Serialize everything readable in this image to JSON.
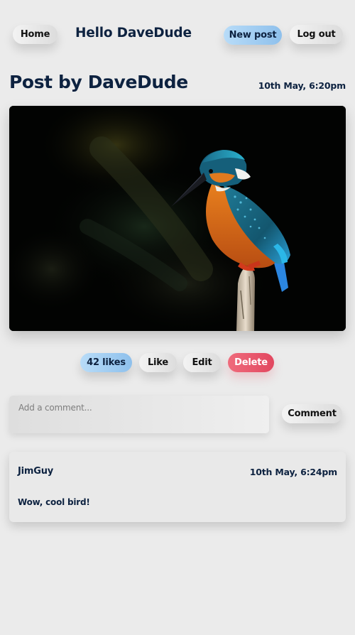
{
  "nav": {
    "home_label": "Home",
    "greeting": "Hello DaveDude",
    "new_post_label": "New post",
    "logout_label": "Log out"
  },
  "post": {
    "title": "Post by DaveDude",
    "timestamp": "10th May, 6:20pm",
    "image_subject": "kingfisher-photo",
    "actions": {
      "likes_label": "42 likes",
      "like_label": "Like",
      "edit_label": "Edit",
      "delete_label": "Delete"
    }
  },
  "comment_form": {
    "placeholder": "Add a comment...",
    "value": "",
    "submit_label": "Comment"
  },
  "comments": [
    {
      "author": "JimGuy",
      "timestamp": "10th May, 6:24pm",
      "text": "Wow, cool bird!"
    }
  ],
  "colors": {
    "background": "#ebebeb",
    "text": "#0d2240",
    "accent_blue": "#8ec0ec",
    "danger_red": "#e2475f"
  }
}
